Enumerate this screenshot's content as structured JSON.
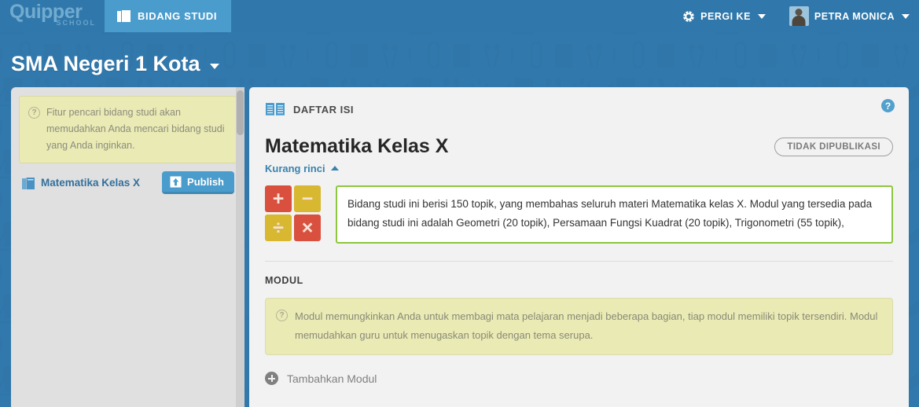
{
  "brand": {
    "name": "Quipper",
    "sub": "SCHOOL"
  },
  "topnav": {
    "tab_label": "BIDANG STUDI",
    "goto_label": "PERGI KE",
    "user_name": "PETRA MONICA"
  },
  "school": {
    "name": "SMA Negeri 1 Kota"
  },
  "sidebar": {
    "hint": "Fitur pencari bidang studi akan memudahkan Anda mencari bidang studi yang Anda inginkan.",
    "hint_icon": "question-circle-icon",
    "subject_name": "Matematika Kelas X",
    "publish_label": "Publish",
    "publish_icon": "upload-icon"
  },
  "main": {
    "section_label": "DAFTAR ISI",
    "section_icon": "open-book-icon",
    "help_icon": "question-mark-icon",
    "help_label": "?",
    "title": "Matematika Kelas X",
    "status_badge": "TIDAK DIPUBLIKASI",
    "toggle_detail_label": "Kurang rinci",
    "toggle_detail_icon": "chevron-up-icon",
    "subject_icon": {
      "name": "math-operators-icon",
      "tiles": [
        {
          "glyph": "+",
          "color": "#d9503f"
        },
        {
          "glyph": "−",
          "color": "#d8b731"
        },
        {
          "glyph": "÷",
          "color": "#d8b731"
        },
        {
          "glyph": "×",
          "color": "#d9503f"
        }
      ]
    },
    "description": "Bidang studi ini berisi 150 topik, yang membahas seluruh materi Matematika kelas X. Modul yang tersedia pada bidang studi ini adalah Geometri (20 topik), Persamaan Fungsi Kuadrat (20 topik), Trigonometri (55 topik),",
    "description_border_color": "#8dc63f"
  },
  "modul": {
    "label": "MODUL",
    "hint": "Modul memungkinkan Anda untuk membagi mata pelajaran menjadi beberapa bagian, tiap modul memiliki topik tersendiri. Modul memudahkan guru untuk menugaskan topik dengan tema serupa.",
    "hint_icon": "question-circle-icon",
    "add_label": "Tambahkan Modul",
    "add_icon": "plus-circle-icon"
  },
  "colors": {
    "page_bg": "#3178ac",
    "nav_tab": "#4a9ccd",
    "panel_bg": "#f2f2f2",
    "sidebar_bg": "#e0e0e0",
    "hint_bg": "#eaeab4",
    "accent_blue": "#3a82ad",
    "green_border": "#8dc63f"
  }
}
